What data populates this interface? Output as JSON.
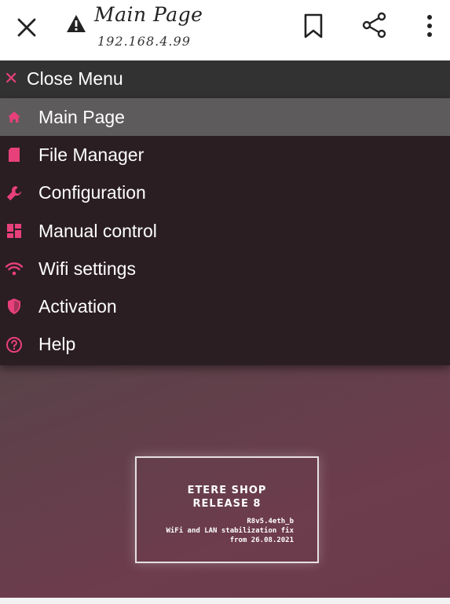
{
  "browser": {
    "title": "Main Page",
    "url": "192.168.4.99",
    "icons": [
      "close-icon",
      "warning-icon",
      "bookmark-icon",
      "share-icon",
      "more-icon"
    ]
  },
  "menu": {
    "close_label": "Close Menu",
    "accent_color": "#e8407a",
    "items": [
      {
        "label": "Main Page",
        "icon": "home-icon",
        "active": true
      },
      {
        "label": "File Manager",
        "icon": "sd-card-icon",
        "active": false
      },
      {
        "label": "Configuration",
        "icon": "wrench-icon",
        "active": false
      },
      {
        "label": "Manual control",
        "icon": "dashboard-icon",
        "active": false
      },
      {
        "label": "Wifi settings",
        "icon": "wifi-icon",
        "active": false
      },
      {
        "label": "Activation",
        "icon": "shield-icon",
        "active": false
      },
      {
        "label": "Help",
        "icon": "help-icon",
        "active": false
      }
    ]
  },
  "release": {
    "title": "ETERE SHOP",
    "subtitle": "RELEASE 8",
    "version": "R8v5.4eth_b",
    "note": "WiFi and LAN stabilization fix",
    "date": "from 26.08.2021"
  }
}
